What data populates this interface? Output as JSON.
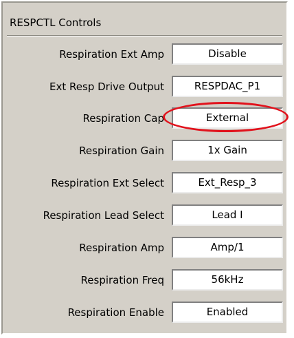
{
  "panel": {
    "title": "RESPCTL Controls"
  },
  "controls": [
    {
      "label": "Respiration Ext Amp",
      "value": "Disable"
    },
    {
      "label": "Ext Resp Drive Output",
      "value": "RESPDAC_P1"
    },
    {
      "label": "Respiration Cap",
      "value": "External"
    },
    {
      "label": "Respiration Gain",
      "value": "1x Gain"
    },
    {
      "label": "Respiration Ext Select",
      "value": "Ext_Resp_3"
    },
    {
      "label": "Respiration Lead Select",
      "value": "Lead I"
    },
    {
      "label": "Respiration Amp",
      "value": "Amp/1"
    },
    {
      "label": "Respiration Freq",
      "value": "56kHz"
    },
    {
      "label": "Respiration Enable",
      "value": "Enabled"
    }
  ],
  "annotation": {
    "highlight_color": "#e1121c"
  }
}
